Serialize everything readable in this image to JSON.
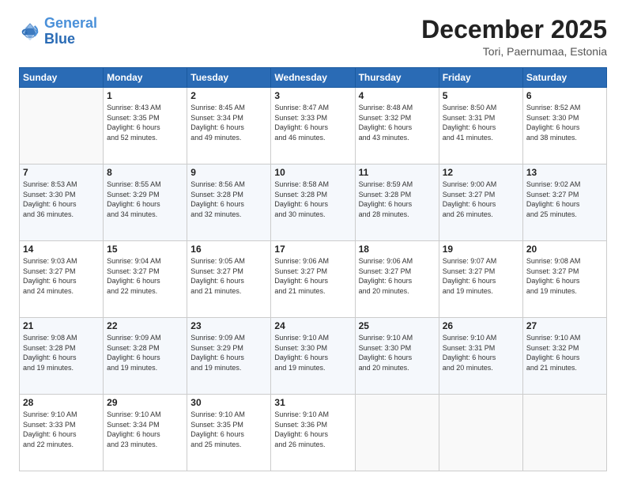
{
  "header": {
    "logo_line1": "General",
    "logo_line2": "Blue",
    "month": "December 2025",
    "location": "Tori, Paernumaa, Estonia"
  },
  "weekdays": [
    "Sunday",
    "Monday",
    "Tuesday",
    "Wednesday",
    "Thursday",
    "Friday",
    "Saturday"
  ],
  "weeks": [
    [
      {
        "day": "",
        "info": ""
      },
      {
        "day": "1",
        "info": "Sunrise: 8:43 AM\nSunset: 3:35 PM\nDaylight: 6 hours\nand 52 minutes."
      },
      {
        "day": "2",
        "info": "Sunrise: 8:45 AM\nSunset: 3:34 PM\nDaylight: 6 hours\nand 49 minutes."
      },
      {
        "day": "3",
        "info": "Sunrise: 8:47 AM\nSunset: 3:33 PM\nDaylight: 6 hours\nand 46 minutes."
      },
      {
        "day": "4",
        "info": "Sunrise: 8:48 AM\nSunset: 3:32 PM\nDaylight: 6 hours\nand 43 minutes."
      },
      {
        "day": "5",
        "info": "Sunrise: 8:50 AM\nSunset: 3:31 PM\nDaylight: 6 hours\nand 41 minutes."
      },
      {
        "day": "6",
        "info": "Sunrise: 8:52 AM\nSunset: 3:30 PM\nDaylight: 6 hours\nand 38 minutes."
      }
    ],
    [
      {
        "day": "7",
        "info": "Sunrise: 8:53 AM\nSunset: 3:30 PM\nDaylight: 6 hours\nand 36 minutes."
      },
      {
        "day": "8",
        "info": "Sunrise: 8:55 AM\nSunset: 3:29 PM\nDaylight: 6 hours\nand 34 minutes."
      },
      {
        "day": "9",
        "info": "Sunrise: 8:56 AM\nSunset: 3:28 PM\nDaylight: 6 hours\nand 32 minutes."
      },
      {
        "day": "10",
        "info": "Sunrise: 8:58 AM\nSunset: 3:28 PM\nDaylight: 6 hours\nand 30 minutes."
      },
      {
        "day": "11",
        "info": "Sunrise: 8:59 AM\nSunset: 3:28 PM\nDaylight: 6 hours\nand 28 minutes."
      },
      {
        "day": "12",
        "info": "Sunrise: 9:00 AM\nSunset: 3:27 PM\nDaylight: 6 hours\nand 26 minutes."
      },
      {
        "day": "13",
        "info": "Sunrise: 9:02 AM\nSunset: 3:27 PM\nDaylight: 6 hours\nand 25 minutes."
      }
    ],
    [
      {
        "day": "14",
        "info": "Sunrise: 9:03 AM\nSunset: 3:27 PM\nDaylight: 6 hours\nand 24 minutes."
      },
      {
        "day": "15",
        "info": "Sunrise: 9:04 AM\nSunset: 3:27 PM\nDaylight: 6 hours\nand 22 minutes."
      },
      {
        "day": "16",
        "info": "Sunrise: 9:05 AM\nSunset: 3:27 PM\nDaylight: 6 hours\nand 21 minutes."
      },
      {
        "day": "17",
        "info": "Sunrise: 9:06 AM\nSunset: 3:27 PM\nDaylight: 6 hours\nand 21 minutes."
      },
      {
        "day": "18",
        "info": "Sunrise: 9:06 AM\nSunset: 3:27 PM\nDaylight: 6 hours\nand 20 minutes."
      },
      {
        "day": "19",
        "info": "Sunrise: 9:07 AM\nSunset: 3:27 PM\nDaylight: 6 hours\nand 19 minutes."
      },
      {
        "day": "20",
        "info": "Sunrise: 9:08 AM\nSunset: 3:27 PM\nDaylight: 6 hours\nand 19 minutes."
      }
    ],
    [
      {
        "day": "21",
        "info": "Sunrise: 9:08 AM\nSunset: 3:28 PM\nDaylight: 6 hours\nand 19 minutes."
      },
      {
        "day": "22",
        "info": "Sunrise: 9:09 AM\nSunset: 3:28 PM\nDaylight: 6 hours\nand 19 minutes."
      },
      {
        "day": "23",
        "info": "Sunrise: 9:09 AM\nSunset: 3:29 PM\nDaylight: 6 hours\nand 19 minutes."
      },
      {
        "day": "24",
        "info": "Sunrise: 9:10 AM\nSunset: 3:30 PM\nDaylight: 6 hours\nand 19 minutes."
      },
      {
        "day": "25",
        "info": "Sunrise: 9:10 AM\nSunset: 3:30 PM\nDaylight: 6 hours\nand 20 minutes."
      },
      {
        "day": "26",
        "info": "Sunrise: 9:10 AM\nSunset: 3:31 PM\nDaylight: 6 hours\nand 20 minutes."
      },
      {
        "day": "27",
        "info": "Sunrise: 9:10 AM\nSunset: 3:32 PM\nDaylight: 6 hours\nand 21 minutes."
      }
    ],
    [
      {
        "day": "28",
        "info": "Sunrise: 9:10 AM\nSunset: 3:33 PM\nDaylight: 6 hours\nand 22 minutes."
      },
      {
        "day": "29",
        "info": "Sunrise: 9:10 AM\nSunset: 3:34 PM\nDaylight: 6 hours\nand 23 minutes."
      },
      {
        "day": "30",
        "info": "Sunrise: 9:10 AM\nSunset: 3:35 PM\nDaylight: 6 hours\nand 25 minutes."
      },
      {
        "day": "31",
        "info": "Sunrise: 9:10 AM\nSunset: 3:36 PM\nDaylight: 6 hours\nand 26 minutes."
      },
      {
        "day": "",
        "info": ""
      },
      {
        "day": "",
        "info": ""
      },
      {
        "day": "",
        "info": ""
      }
    ]
  ]
}
